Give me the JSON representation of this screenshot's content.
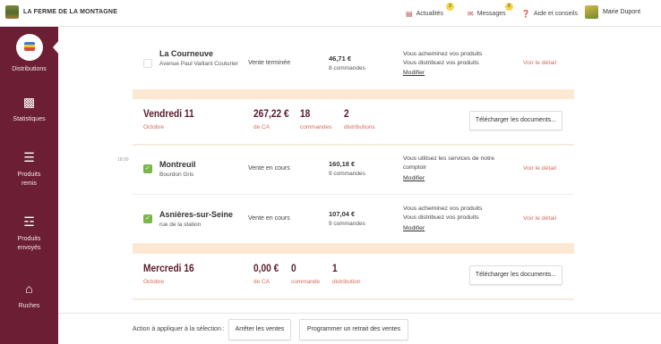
{
  "app": {
    "brand": "LA FERME DE LA MONTAGNE"
  },
  "header": {
    "news": {
      "label": "Actualités",
      "count": "2"
    },
    "messages": {
      "label": "Messages",
      "count": "6"
    },
    "help": {
      "label": "Aide et conseils"
    },
    "user": {
      "name": "Marie Dupont"
    }
  },
  "sidebar": {
    "items": [
      {
        "label": "Distributions",
        "icon": "distributions-icon",
        "active": true
      },
      {
        "label": "Statistiques",
        "icon": "bar-chart-icon"
      },
      {
        "label": "Produits remis",
        "icon": "list-icon"
      },
      {
        "label": "Produits envoyés",
        "icon": "stack-icon"
      },
      {
        "label": "Ruches",
        "icon": "barn-icon"
      }
    ]
  },
  "top_row": {
    "name": "La Courneuve",
    "address": "Avenue Paul Vaillant Couturier",
    "status": "Vente terminée",
    "amount": "46,71 €",
    "orders": "8 commandes",
    "info_lines": [
      "Vous acheminez vos produits",
      "Vous distribuez vos produits"
    ],
    "modify": "Modifier",
    "detail": "Voir le détail"
  },
  "days": [
    {
      "day": "Vendredi 11",
      "month": "Octobre",
      "ca_value": "267,22 €",
      "ca_label": "de CA",
      "orders_value": "18",
      "orders_label": "commandes",
      "dist_value": "2",
      "dist_label": "distributions",
      "download": "Télécharger les documents...",
      "time": "18:00",
      "rows": [
        {
          "name": "Montreuil",
          "address": "Bourdon Gris",
          "status": "Vente en cours",
          "amount": "160,18 €",
          "orders": "9 commandes",
          "info_lines": [
            "Vous utilisez les services de notre comptoir"
          ],
          "modify": "Modifier",
          "detail": "Voir le détail",
          "checked": true
        },
        {
          "name": "Asnières-sur-Seine",
          "address": "rue de la station",
          "status": "Vente en cours",
          "amount": "107,04 €",
          "orders": "9 commandes",
          "info_lines": [
            "Vous acheminez vos produits",
            "Vous distribuez vos produits"
          ],
          "modify": "Modifier",
          "detail": "Voir le détail",
          "checked": true
        }
      ]
    },
    {
      "day": "Mercredi 16",
      "month": "Octobre",
      "ca_value": "0,00 €",
      "ca_label": "de CA",
      "orders_value": "0",
      "orders_label": "commande",
      "dist_value": "1",
      "dist_label": "distribution",
      "download": "Télécharger les documents..."
    }
  ],
  "action_bar": {
    "label": "Action à appliquer à la sélection :",
    "stop_sales": "Arrêter les ventes",
    "schedule_withdrawal": "Programmer un retrait des ventes"
  },
  "colors": {
    "sidebar": "#6b1e34",
    "accent": "#d56a5a",
    "peach": "#fde8d4",
    "check": "#7ab648"
  }
}
